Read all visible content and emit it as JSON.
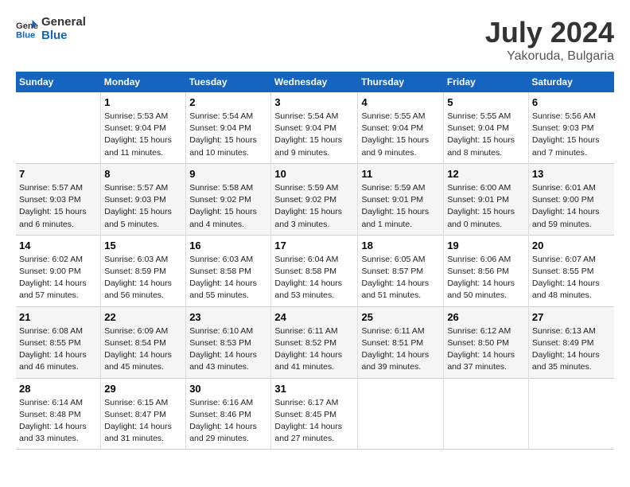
{
  "header": {
    "logo_general": "General",
    "logo_blue": "Blue",
    "month": "July 2024",
    "location": "Yakoruda, Bulgaria"
  },
  "weekdays": [
    "Sunday",
    "Monday",
    "Tuesday",
    "Wednesday",
    "Thursday",
    "Friday",
    "Saturday"
  ],
  "weeks": [
    [
      {
        "day": "",
        "info": ""
      },
      {
        "day": "1",
        "info": "Sunrise: 5:53 AM\nSunset: 9:04 PM\nDaylight: 15 hours\nand 11 minutes."
      },
      {
        "day": "2",
        "info": "Sunrise: 5:54 AM\nSunset: 9:04 PM\nDaylight: 15 hours\nand 10 minutes."
      },
      {
        "day": "3",
        "info": "Sunrise: 5:54 AM\nSunset: 9:04 PM\nDaylight: 15 hours\nand 9 minutes."
      },
      {
        "day": "4",
        "info": "Sunrise: 5:55 AM\nSunset: 9:04 PM\nDaylight: 15 hours\nand 9 minutes."
      },
      {
        "day": "5",
        "info": "Sunrise: 5:55 AM\nSunset: 9:04 PM\nDaylight: 15 hours\nand 8 minutes."
      },
      {
        "day": "6",
        "info": "Sunrise: 5:56 AM\nSunset: 9:03 PM\nDaylight: 15 hours\nand 7 minutes."
      }
    ],
    [
      {
        "day": "7",
        "info": "Sunrise: 5:57 AM\nSunset: 9:03 PM\nDaylight: 15 hours\nand 6 minutes."
      },
      {
        "day": "8",
        "info": "Sunrise: 5:57 AM\nSunset: 9:03 PM\nDaylight: 15 hours\nand 5 minutes."
      },
      {
        "day": "9",
        "info": "Sunrise: 5:58 AM\nSunset: 9:02 PM\nDaylight: 15 hours\nand 4 minutes."
      },
      {
        "day": "10",
        "info": "Sunrise: 5:59 AM\nSunset: 9:02 PM\nDaylight: 15 hours\nand 3 minutes."
      },
      {
        "day": "11",
        "info": "Sunrise: 5:59 AM\nSunset: 9:01 PM\nDaylight: 15 hours\nand 1 minute."
      },
      {
        "day": "12",
        "info": "Sunrise: 6:00 AM\nSunset: 9:01 PM\nDaylight: 15 hours\nand 0 minutes."
      },
      {
        "day": "13",
        "info": "Sunrise: 6:01 AM\nSunset: 9:00 PM\nDaylight: 14 hours\nand 59 minutes."
      }
    ],
    [
      {
        "day": "14",
        "info": "Sunrise: 6:02 AM\nSunset: 9:00 PM\nDaylight: 14 hours\nand 57 minutes."
      },
      {
        "day": "15",
        "info": "Sunrise: 6:03 AM\nSunset: 8:59 PM\nDaylight: 14 hours\nand 56 minutes."
      },
      {
        "day": "16",
        "info": "Sunrise: 6:03 AM\nSunset: 8:58 PM\nDaylight: 14 hours\nand 55 minutes."
      },
      {
        "day": "17",
        "info": "Sunrise: 6:04 AM\nSunset: 8:58 PM\nDaylight: 14 hours\nand 53 minutes."
      },
      {
        "day": "18",
        "info": "Sunrise: 6:05 AM\nSunset: 8:57 PM\nDaylight: 14 hours\nand 51 minutes."
      },
      {
        "day": "19",
        "info": "Sunrise: 6:06 AM\nSunset: 8:56 PM\nDaylight: 14 hours\nand 50 minutes."
      },
      {
        "day": "20",
        "info": "Sunrise: 6:07 AM\nSunset: 8:55 PM\nDaylight: 14 hours\nand 48 minutes."
      }
    ],
    [
      {
        "day": "21",
        "info": "Sunrise: 6:08 AM\nSunset: 8:55 PM\nDaylight: 14 hours\nand 46 minutes."
      },
      {
        "day": "22",
        "info": "Sunrise: 6:09 AM\nSunset: 8:54 PM\nDaylight: 14 hours\nand 45 minutes."
      },
      {
        "day": "23",
        "info": "Sunrise: 6:10 AM\nSunset: 8:53 PM\nDaylight: 14 hours\nand 43 minutes."
      },
      {
        "day": "24",
        "info": "Sunrise: 6:11 AM\nSunset: 8:52 PM\nDaylight: 14 hours\nand 41 minutes."
      },
      {
        "day": "25",
        "info": "Sunrise: 6:11 AM\nSunset: 8:51 PM\nDaylight: 14 hours\nand 39 minutes."
      },
      {
        "day": "26",
        "info": "Sunrise: 6:12 AM\nSunset: 8:50 PM\nDaylight: 14 hours\nand 37 minutes."
      },
      {
        "day": "27",
        "info": "Sunrise: 6:13 AM\nSunset: 8:49 PM\nDaylight: 14 hours\nand 35 minutes."
      }
    ],
    [
      {
        "day": "28",
        "info": "Sunrise: 6:14 AM\nSunset: 8:48 PM\nDaylight: 14 hours\nand 33 minutes."
      },
      {
        "day": "29",
        "info": "Sunrise: 6:15 AM\nSunset: 8:47 PM\nDaylight: 14 hours\nand 31 minutes."
      },
      {
        "day": "30",
        "info": "Sunrise: 6:16 AM\nSunset: 8:46 PM\nDaylight: 14 hours\nand 29 minutes."
      },
      {
        "day": "31",
        "info": "Sunrise: 6:17 AM\nSunset: 8:45 PM\nDaylight: 14 hours\nand 27 minutes."
      },
      {
        "day": "",
        "info": ""
      },
      {
        "day": "",
        "info": ""
      },
      {
        "day": "",
        "info": ""
      }
    ]
  ]
}
